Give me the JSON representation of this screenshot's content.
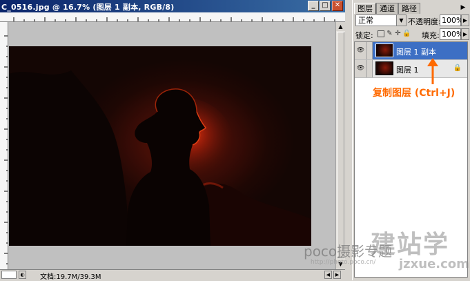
{
  "window": {
    "title": "C_0516.jpg @ 16.7% (图层 1 副本, RGB/8)",
    "minimize_icon": "minimize-icon",
    "maximize_icon": "maximize-icon",
    "close_icon": "close-icon"
  },
  "status": {
    "doc_size": "文档:19.7M/39.3M"
  },
  "palette": {
    "tabs": [
      {
        "label": "图层",
        "active": true
      },
      {
        "label": "通道",
        "active": false
      },
      {
        "label": "路径",
        "active": false
      }
    ],
    "blend_mode": "正常",
    "opacity_label": "不透明度:",
    "opacity_value": "100%",
    "lock_label": "锁定:",
    "fill_label": "填充:",
    "fill_value": "100%",
    "layers": [
      {
        "name": "图层 1 副本",
        "selected": true,
        "locked": false
      },
      {
        "name": "图层 1",
        "selected": false,
        "locked": true
      }
    ]
  },
  "annotation": {
    "text": "复制图层 (Ctrl+J)",
    "color": "#ff6a00"
  },
  "watermarks": {
    "poco": "poco摄影专题",
    "poco_url": "http://photo.poco.cn/",
    "site": "建站学",
    "site_url": "jzxue.com"
  }
}
